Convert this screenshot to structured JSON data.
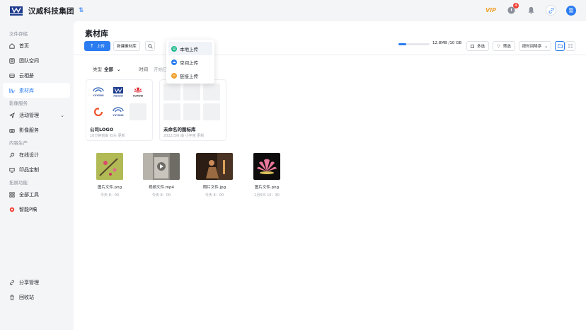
{
  "header": {
    "brand": "汉威科技集团",
    "switch_icon": "swap-icon",
    "vip": "VIP",
    "notice_badge": "4",
    "avatar_text": "雷"
  },
  "sidebar": {
    "sections": [
      {
        "title": "文件存储",
        "items": [
          "首页",
          "团队空间",
          "云相册",
          "素材库"
        ]
      },
      {
        "title": "影像服务",
        "items": [
          "活动管理",
          "影像服务"
        ]
      },
      {
        "title": "内容生产",
        "items": [
          "在线设计",
          "印品定制"
        ]
      },
      {
        "title": "拓展功能",
        "items": [
          "全部工具",
          "智能P稿"
        ]
      }
    ],
    "bottom": [
      "分享管理",
      "回收站"
    ],
    "active": "素材库"
  },
  "main": {
    "title": "素材库",
    "upload_btn": "上传",
    "new_lib_btn": "新建素材库",
    "storage": {
      "text": "12.8MB /10 GB",
      "fraction": 0.0013
    },
    "multi_select": "多选",
    "filter_btn": "筛选",
    "sort_btn": "按时间降序",
    "filter_type_label": "类型",
    "filter_type_value": "全部",
    "filter_time_label": "时间",
    "filter_time_start": "开始日"
  },
  "upload_menu": [
    "本地上传",
    "空间上传",
    "链接上传"
  ],
  "libraries": [
    {
      "name": "公司LOGO",
      "meta": "10分钟前由 石头 更新",
      "logos": [
        "YUYONG",
        "Hanwei",
        "HUAWEI",
        "",
        "YUYONG",
        ""
      ]
    },
    {
      "name": "未命名的图标库",
      "meta": "2022/3/6 由 小宇宙 更新"
    }
  ],
  "files": [
    {
      "name": "图片文件.png",
      "date": "今天 8：00"
    },
    {
      "name": "视频文件.mp4",
      "date": "今天 8：00"
    },
    {
      "name": "照片文件.jpg",
      "date": "今天 8：00"
    },
    {
      "name": "图片文件.png",
      "date": "1月5日 10：30"
    }
  ]
}
